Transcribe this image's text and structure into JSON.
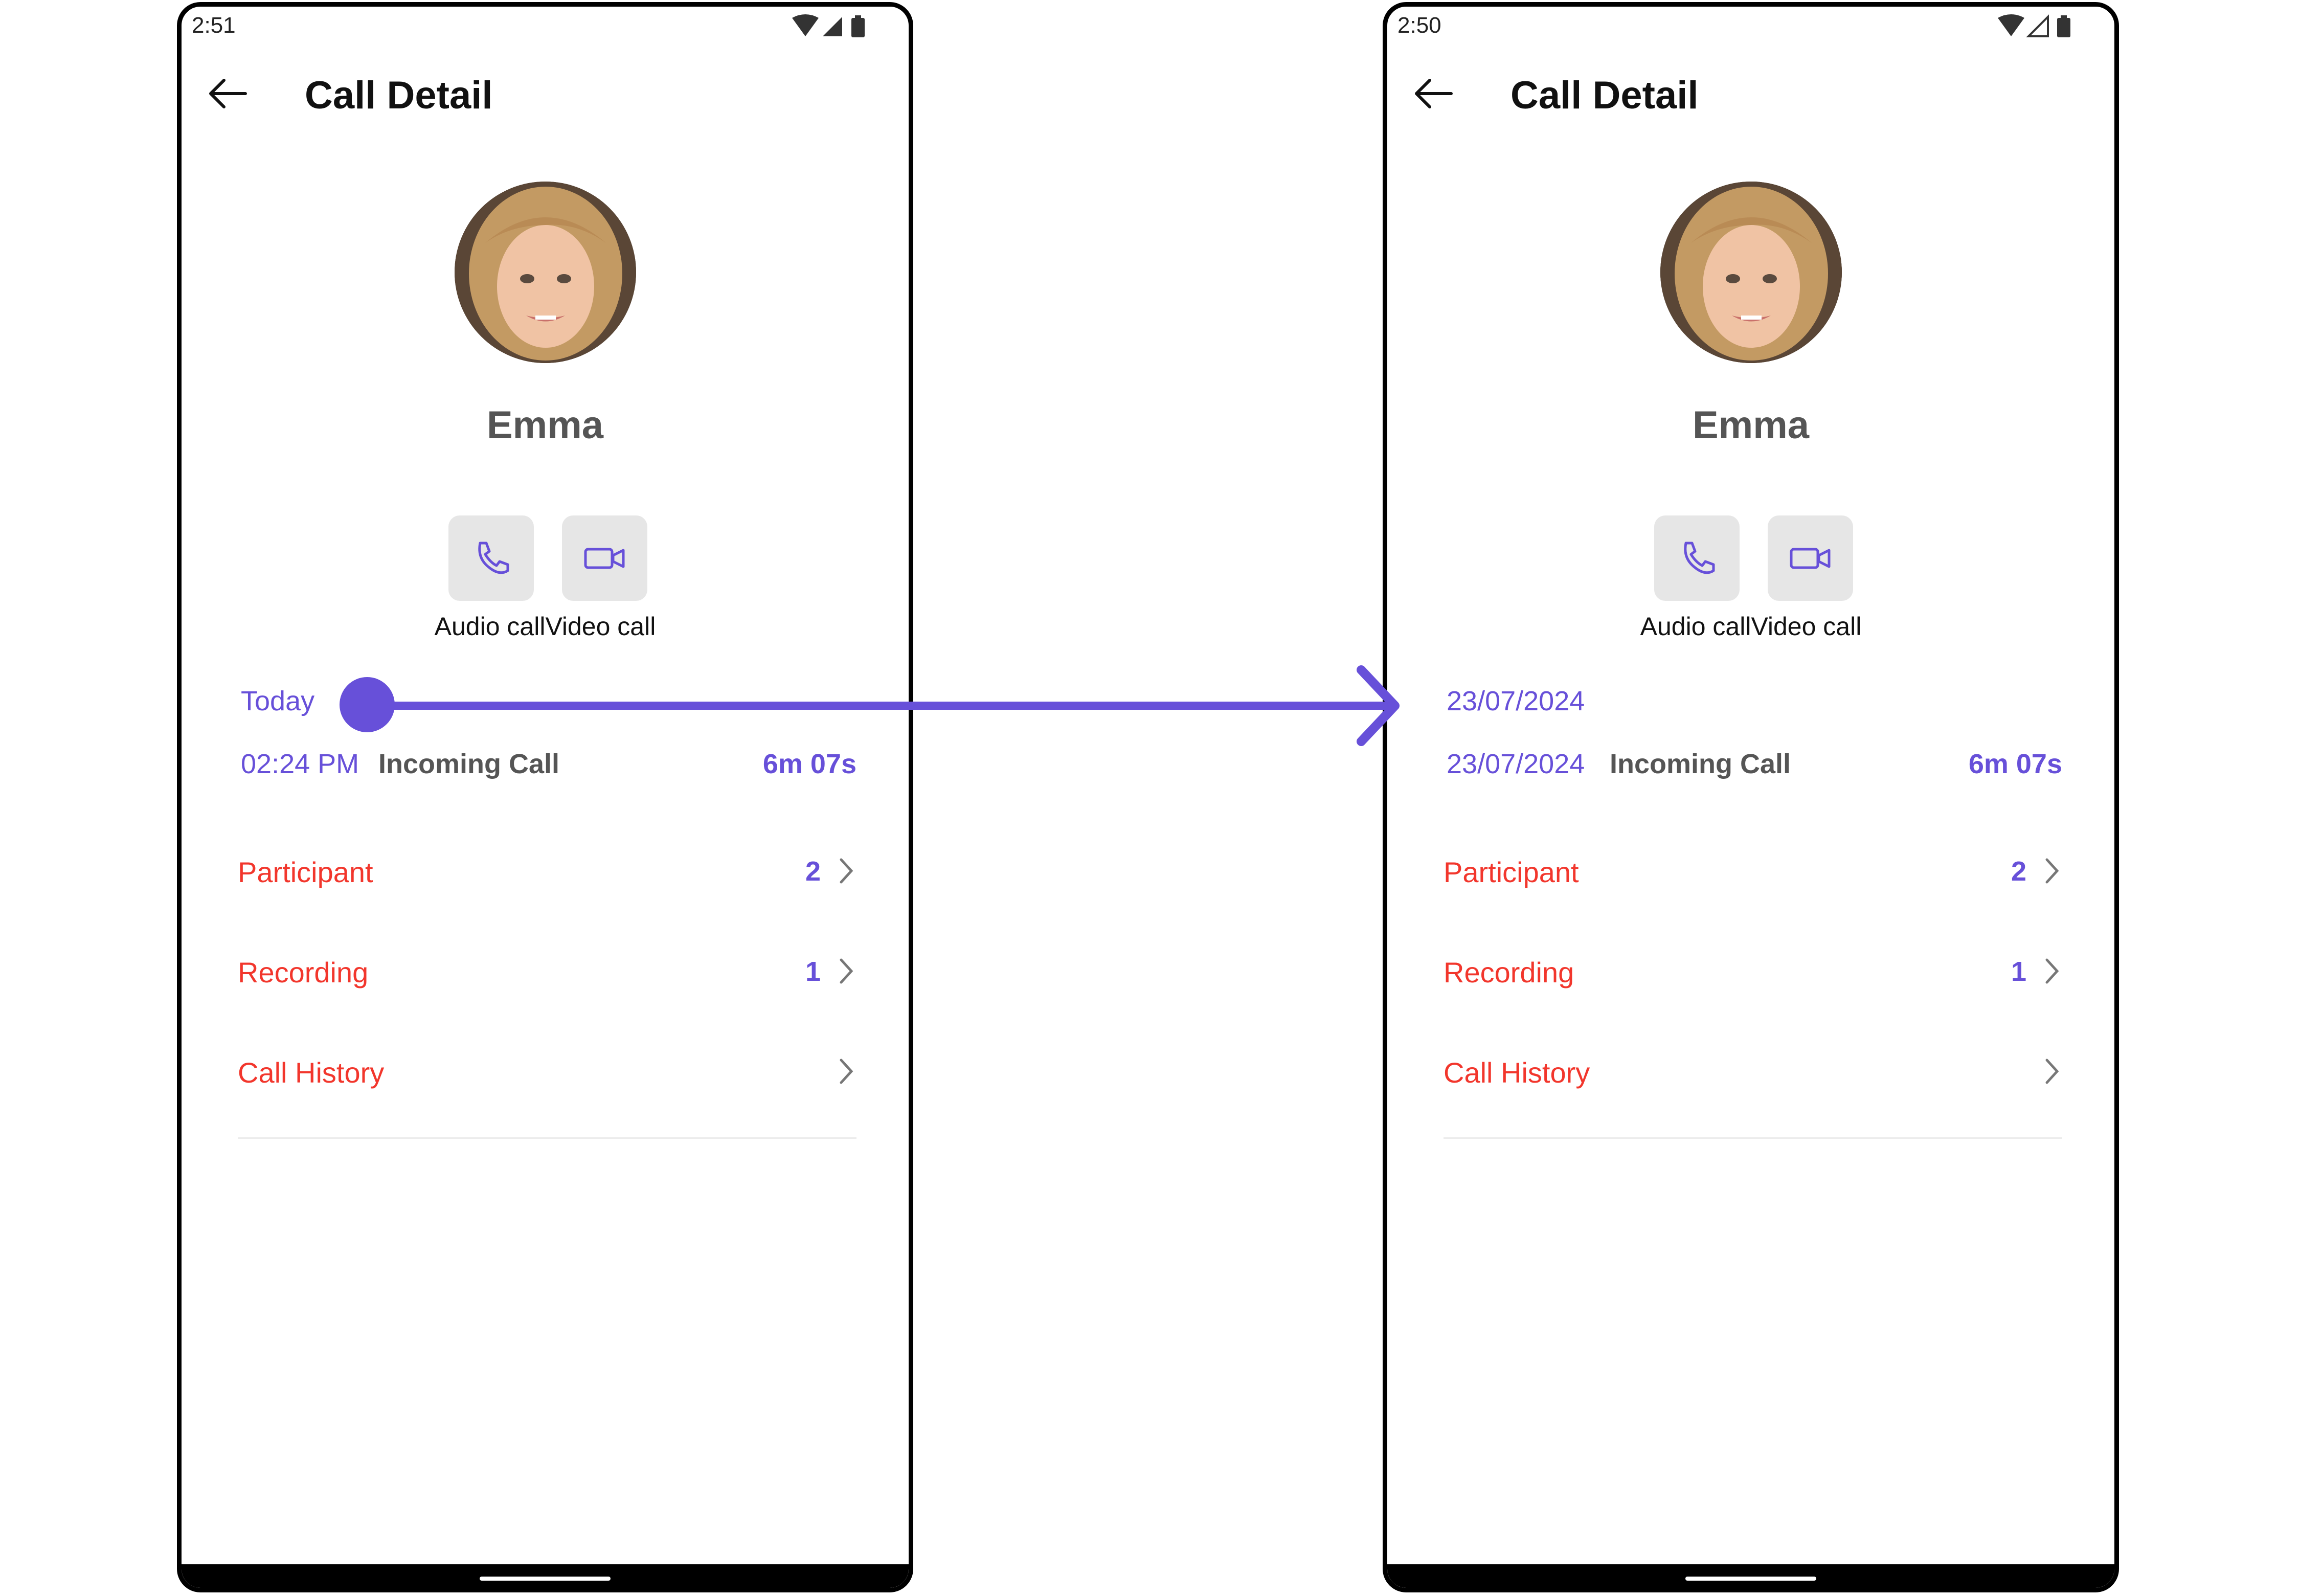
{
  "screens": [
    {
      "status_time": "2:51",
      "title": "Call Detail",
      "user_name": "Emma",
      "audio_call_label": "Audio call",
      "video_call_label": "Video call",
      "date_header": "Today",
      "call_time": "02:24 PM",
      "call_type": "Incoming Call",
      "call_duration": "6m 07s",
      "options": [
        {
          "label": "Participant",
          "count": "2"
        },
        {
          "label": "Recording",
          "count": "1"
        },
        {
          "label": "Call History",
          "count": ""
        }
      ]
    },
    {
      "status_time": "2:50",
      "title": "Call Detail",
      "user_name": "Emma",
      "audio_call_label": "Audio call",
      "video_call_label": "Video call",
      "date_header": "23/07/2024",
      "call_time": "23/07/2024",
      "call_type": "Incoming Call",
      "call_duration": "6m 07s",
      "options": [
        {
          "label": "Participant",
          "count": "2"
        },
        {
          "label": "Recording",
          "count": "1"
        },
        {
          "label": "Call History",
          "count": ""
        }
      ]
    }
  ],
  "colors": {
    "accent": "#6750d9",
    "option_label": "#f2362c",
    "button_bg": "#e6e6e6",
    "name_text": "#555555"
  },
  "icons": {
    "back": "arrow-left-icon",
    "audio": "phone-icon",
    "video": "video-camera-icon",
    "chevron": "chevron-right-icon",
    "status": [
      "wifi-icon",
      "signal-icon",
      "battery-icon"
    ]
  }
}
